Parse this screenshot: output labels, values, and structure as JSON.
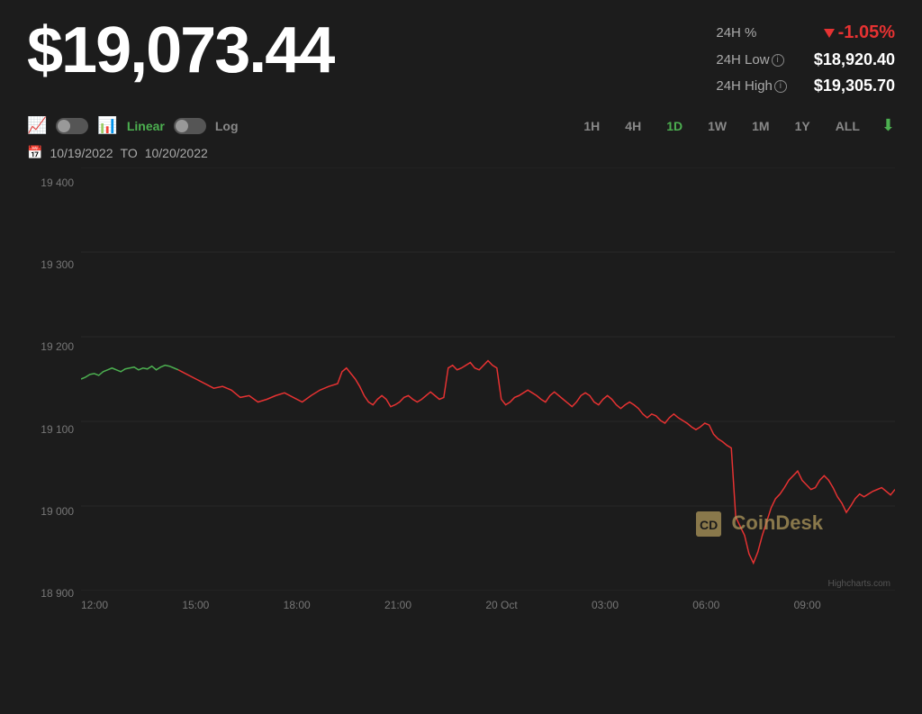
{
  "header": {
    "price": "$19,073.44",
    "stats": {
      "change_label": "24H %",
      "change_value": "-1.05%",
      "low_label": "24H Low",
      "low_value": "$18,920.40",
      "high_label": "24H High",
      "high_value": "$19,305.70"
    }
  },
  "controls": {
    "chart_type_line_icon": "📈",
    "chart_type_bar_icon": "📊",
    "scale_linear": "Linear",
    "scale_log": "Log",
    "time_periods": [
      "1H",
      "4H",
      "1D",
      "1W",
      "1M",
      "1Y",
      "ALL"
    ],
    "active_period": "1D",
    "download_icon": "⬇"
  },
  "date_range": {
    "from": "10/19/2022",
    "to": "10/20/2022"
  },
  "chart": {
    "y_labels": [
      "19 400",
      "19 300",
      "19 200",
      "19 100",
      "19 000",
      "18 900"
    ],
    "x_labels": [
      "12:00",
      "15:00",
      "18:00",
      "21:00",
      "20 Oct",
      "03:00",
      "06:00",
      "09:00",
      ""
    ]
  },
  "watermark": {
    "text": "CoinDesk"
  },
  "footer": {
    "credit": "Highcharts.com"
  }
}
